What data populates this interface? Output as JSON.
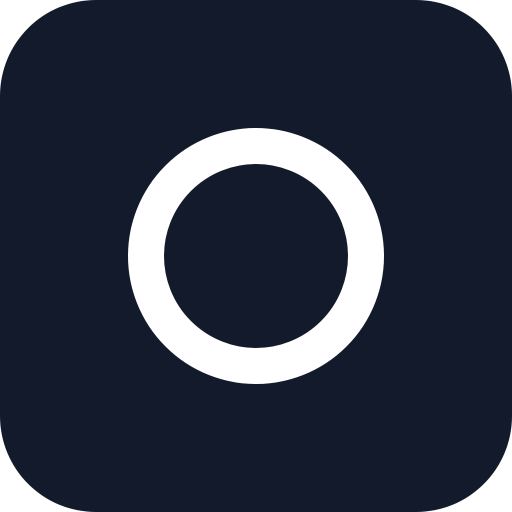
{
  "app_icon": {
    "icon": "circle-outline-icon",
    "colors": {
      "tile_background": "#131a2b",
      "ring": "#ffffff",
      "page_background": "#ffffff"
    }
  }
}
